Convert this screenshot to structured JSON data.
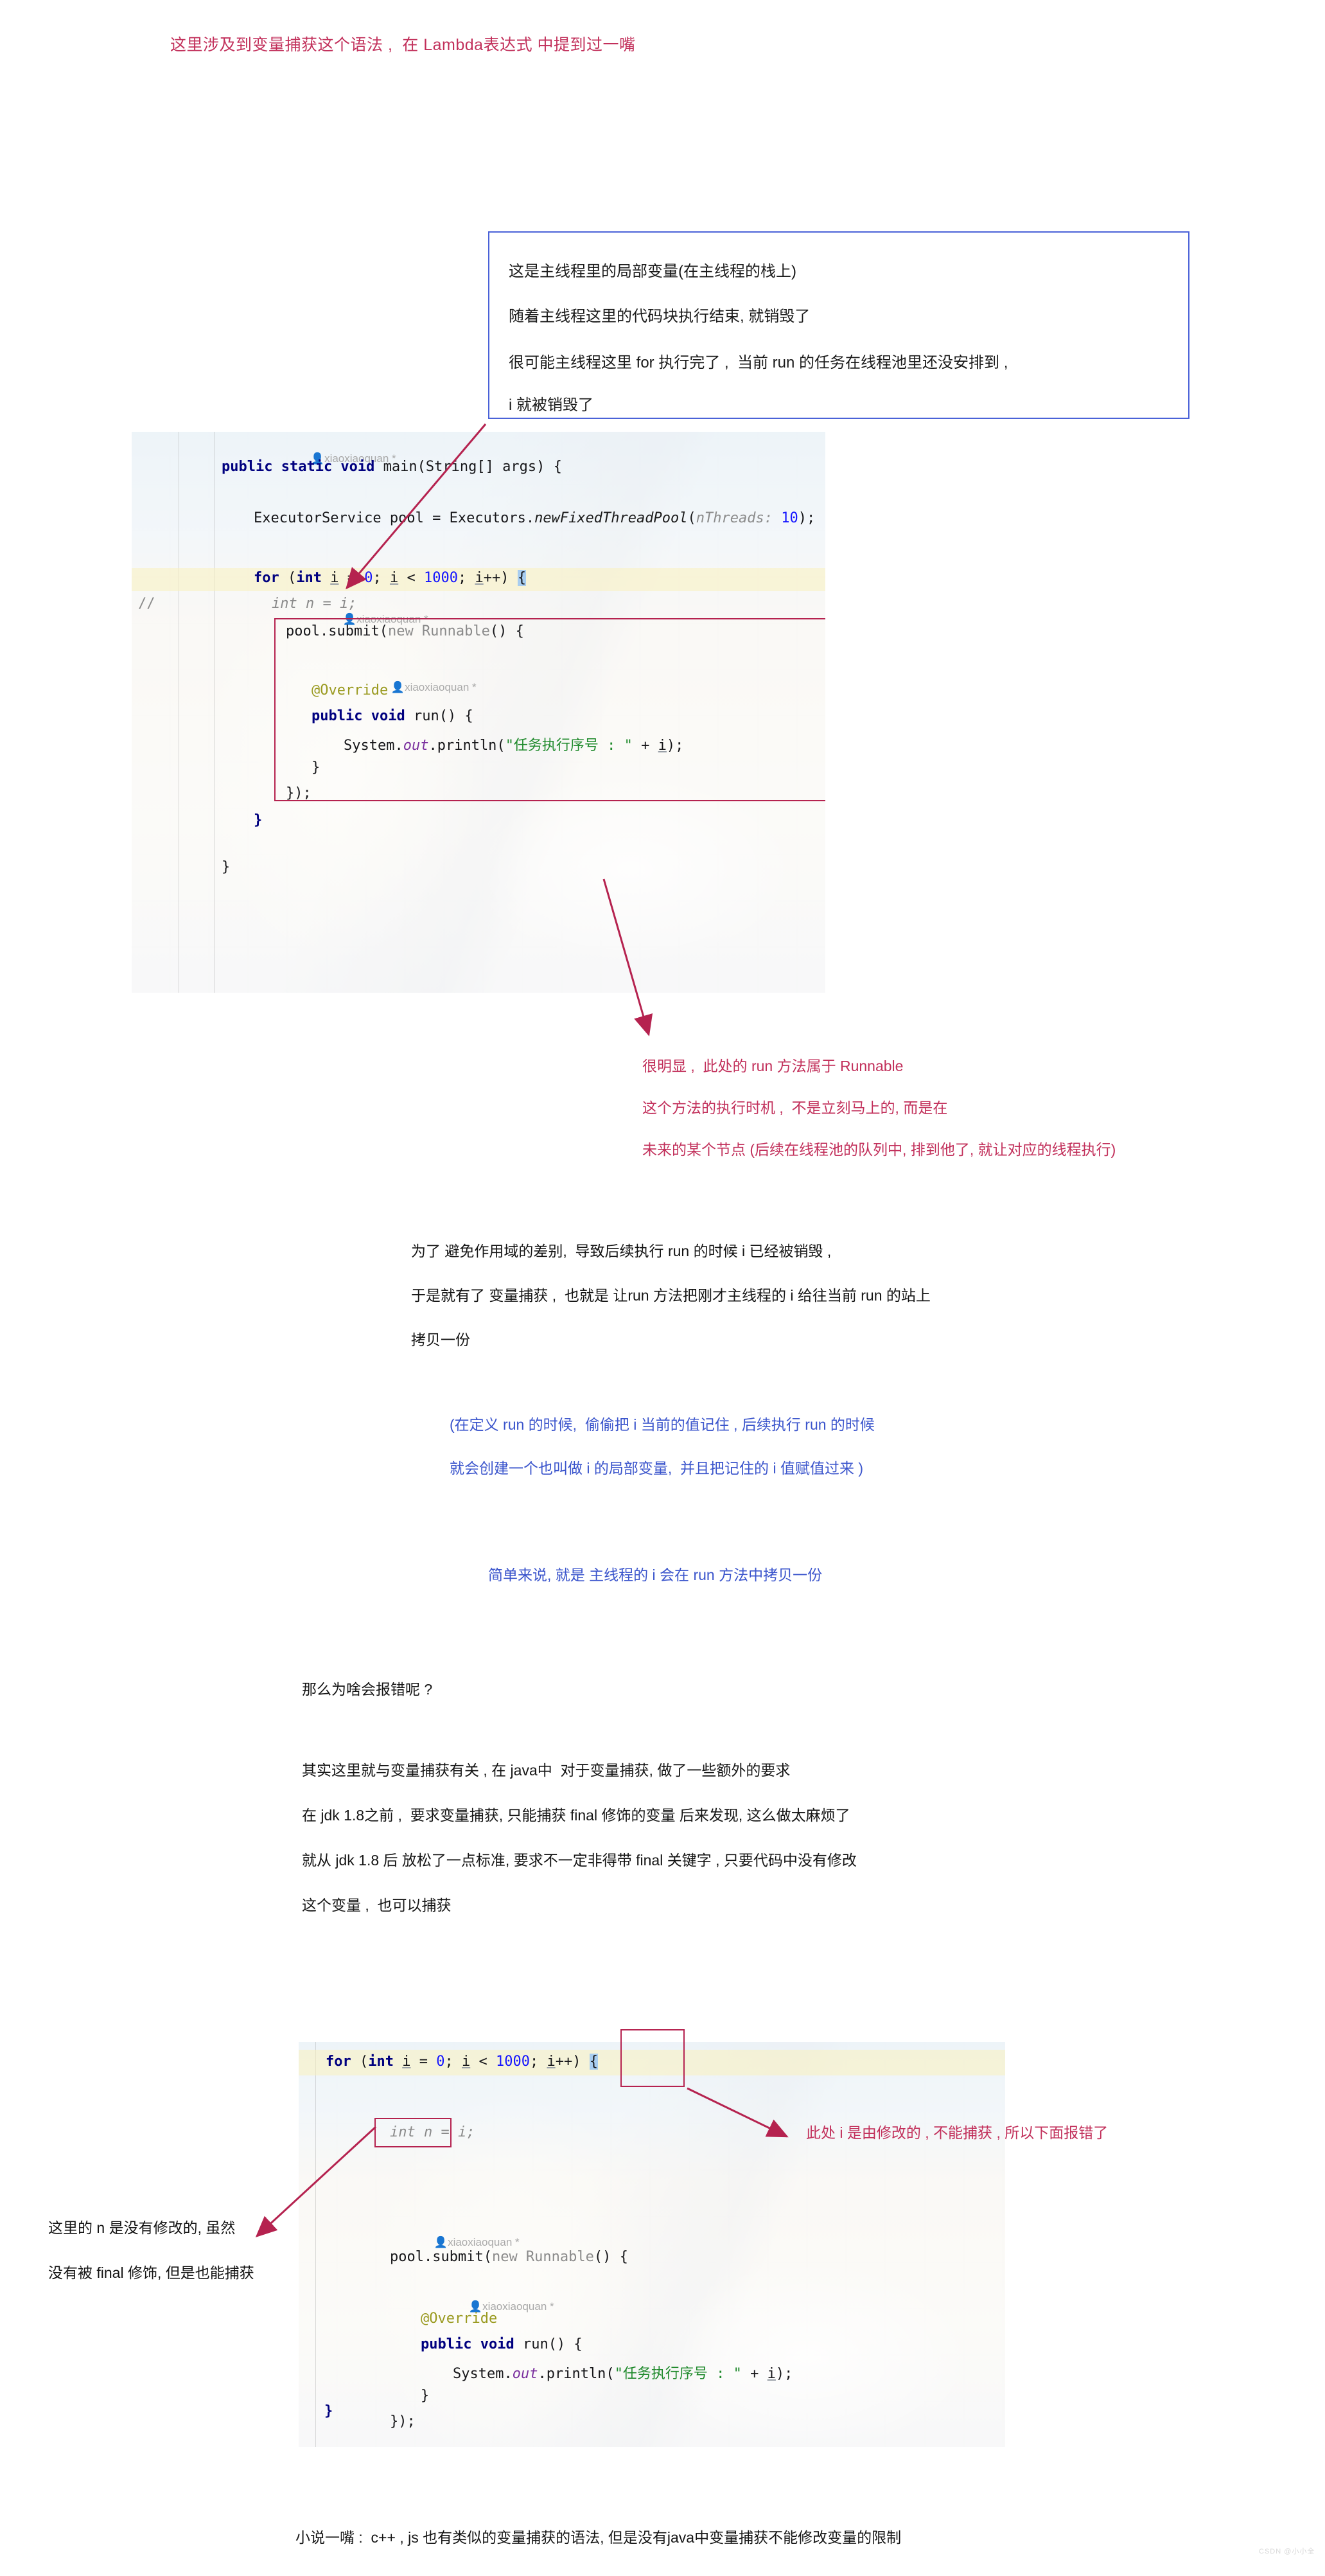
{
  "heading": "这里涉及到变量捕获这个语法 ,  在 Lambda表达式 中提到过一嘴",
  "callout": {
    "lines": [
      "这是主线程里的局部变量(在主线程的栈上)",
      "随着主线程这里的代码块执行结束, 就销毁了",
      "很可能主线程这里 for 执行完了 ,  当前 run 的任务在线程池里还没安排到 ,",
      "i 就被销毁了"
    ]
  },
  "code_block_1": {
    "vcs_annotations": [
      "xiaoxiaoquan *",
      "xiaoxiaoquan *",
      "xiaoxiaoquan *"
    ],
    "lines": [
      "public static void main(String[] args) {",
      "    ExecutorService pool = Executors.newFixedThreadPool(nThreads: 10);",
      "    for (int i = 0; i < 1000; i++) {",
      "//        int n = i;",
      "        pool.submit(new Runnable() {",
      "            @Override",
      "            public void run() {",
      "                System.out.println(\"任务执行序号 : \" + i);",
      "            }",
      "        });",
      "    }",
      "}"
    ],
    "highlighted_line": "for (int i = 0; i < 1000; i++) {",
    "comment_marker": "//",
    "param_hint": "nThreads:",
    "string_literal": "\"任务执行序号 : \"",
    "loop_count": "1000"
  },
  "note_red_1": [
    "很明显 ,  此处的 run 方法属于 Runnable",
    "这个方法的执行时机 ,  不是立刻马上的, 而是在",
    "未来的某个节点 (后续在线程池的队列中, 排到他了, 就让对应的线程执行)"
  ],
  "note_black_1": [
    "为了 避免作用域的差别,  导致后续执行 run 的时候 i 已经被销毁 ,",
    "于是就有了 变量捕获 ,  也就是 让run 方法把刚才主线程的 i 给往当前 run 的站上",
    "拷贝一份"
  ],
  "note_blue_1": [
    "(在定义 run 的时候,  偷偷把 i 当前的值记住 , 后续执行 run 的时候",
    "就会创建一个也叫做 i 的局部变量,  并且把记住的 i 值赋值过来 )"
  ],
  "note_blue_2": "简单来说, 就是 主线程的 i 会在 run 方法中拷贝一份",
  "note_black_2": [
    "那么为啥会报错呢 ?",
    "其实这里就与变量捕获有关 , 在 java中  对于变量捕获, 做了一些额外的要求",
    "在 jdk 1.8之前 ,  要求变量捕获, 只能捕获 final 修饰的变量 后来发现, 这么做太麻烦了",
    "就从 jdk 1.8 后 放松了一点标准, 要求不一定非得带 final 关键字 , 只要代码中没有修改",
    "这个变量 ,  也可以捕获"
  ],
  "code_block_2": {
    "vcs_annotations": [
      "xiaoxiaoquan *",
      "xiaoxiaoquan *"
    ],
    "lines": [
      "for (int i = 0; i < 1000; i++) {",
      "    int n = i;",
      "    pool.submit(new Runnable() {",
      "        @Override",
      "        public void run() {",
      "            System.out.println(\"任务执行序号 : \" + i);",
      "        }",
      "    });",
      "}"
    ],
    "highlighted_line": "for (int i = 0; i < 1000; i++) {",
    "boxed_tokens": [
      "i++)",
      "int n = i;"
    ]
  },
  "note_red_2": "此处 i 是由修改的 , 不能捕获 , 所以下面报错了",
  "note_black_3": [
    "这里的 n 是没有修改的, 虽然",
    "没有被 final 修饰, 但是也能捕获"
  ],
  "note_bottom": "小说一嘴 :  c++ , js 也有类似的变量捕获的语法, 但是没有java中变量捕获不能修改变量的限制",
  "watermark": "CSDN @小小全",
  "colors": {
    "red": "#c2305b",
    "blue": "#3b55cc",
    "callout_border": "#4a62d8",
    "rect_border": "#b5224f",
    "code_bg": "#f7f5f1",
    "highlight": "#faf0be"
  }
}
